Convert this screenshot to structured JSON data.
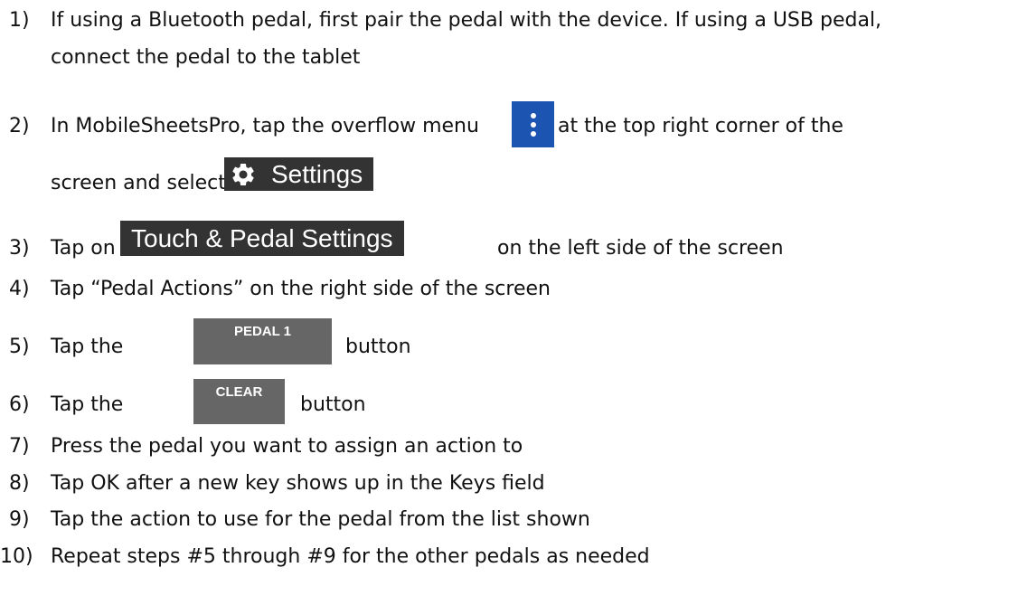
{
  "steps": [
    {
      "num": "1)",
      "line1": "If using a Bluetooth pedal, first pair the pedal with the device. If using a USB pedal,",
      "line2": "connect the pedal to the tablet"
    },
    {
      "num": "2)",
      "text_a": "In MobileSheetsPro, tap the overflow menu",
      "text_b": "at the top right corner of the",
      "text_c": "screen and select"
    },
    {
      "num": "3)",
      "text_a": "Tap on",
      "text_b": "on the left side of the screen"
    },
    {
      "num": "4)",
      "text": "Tap “Pedal Actions” on the right side of the screen"
    },
    {
      "num": "5)",
      "text_a": "Tap the",
      "text_b": "button"
    },
    {
      "num": "6)",
      "text_a": "Tap the",
      "text_b": "button"
    },
    {
      "num": "7)",
      "text": "Press the pedal you want to assign an action to"
    },
    {
      "num": "8)",
      "text": "Tap OK after a new key shows up in the Keys field"
    },
    {
      "num": "9)",
      "text": "Tap the action to use for the pedal from the list shown"
    },
    {
      "num": "10)",
      "text": "Repeat steps #5 through #9 for the other pedals as needed"
    }
  ],
  "ui": {
    "overflow_menu_icon": "more-vert-icon",
    "settings_icon": "gear-icon",
    "settings_label": "Settings",
    "touch_pedal_label": "Touch & Pedal Settings",
    "pedal1_label": "PEDAL 1",
    "clear_label": "CLEAR"
  },
  "colors": {
    "overflow_icon_bg": "#1c54b2",
    "chip_bg": "#333333",
    "button_bg": "#666666"
  }
}
